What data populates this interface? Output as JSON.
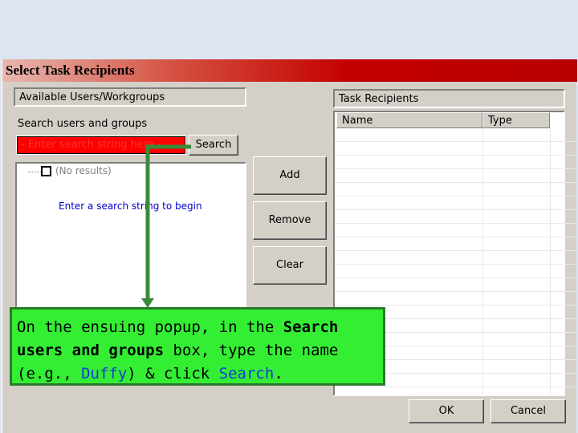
{
  "dialog": {
    "title": "Select Task Recipients",
    "available_label": "Available Users/Workgroups",
    "search_label": "Search users and groups",
    "search_input_value": "- Enter search string here -",
    "search_button": "Search",
    "tree": {
      "no_results": "(No results)",
      "hint": "Enter a search string to begin"
    },
    "add_button": "Add",
    "remove_button": "Remove",
    "clear_button": "Clear",
    "recipients_label": "Task Recipients",
    "columns": [
      "Name",
      "Type"
    ],
    "ok_button": "OK",
    "cancel_button": "Cancel"
  },
  "callout": {
    "part1": "On the ensuing popup, in the ",
    "search_strong": "Search",
    "part2": " ",
    "users_strong": "users and groups",
    "part3": " box, type the name (e.g., ",
    "example": "Duffy",
    "part4": ") & click ",
    "search_blue": "Search",
    "part5": "."
  },
  "colors": {
    "titlebar_start": "#e8b8b0",
    "titlebar_end": "#b80000",
    "callout_bg": "#33ee33",
    "arrow": "#3a8a3a",
    "hint_text": "#0000cc"
  }
}
